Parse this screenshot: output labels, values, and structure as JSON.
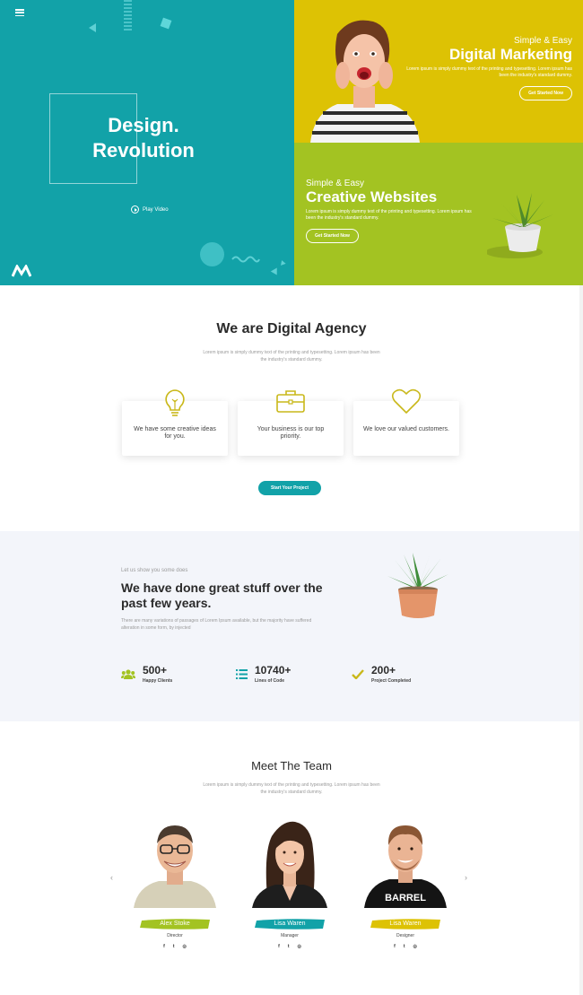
{
  "hero": {
    "left": {
      "title_line1": "Design.",
      "title_line2": "Revolution",
      "play_label": "Play Video"
    },
    "top_right": {
      "kicker": "Simple & Easy",
      "title": "Digital Marketing",
      "desc": "Lorem ipsum is simply dummy text of the printing and typesetting. Lorem ipsum has been the industry's standard dummy.",
      "button": "Get Started Now"
    },
    "bottom_right": {
      "kicker": "Simple & Easy",
      "title": "Creative Websites",
      "desc": "Lorem ipsum is simply dummy text of the printing and typesetting. Lorem ipsum has been the industry's standard dummy.",
      "button": "Get Started Now"
    }
  },
  "agency": {
    "title": "We are Digital Agency",
    "subtitle": "Lorem ipsum is simply dummy text of the printing and typesetting. Lorem ipsum has been the industry's standard dummy.",
    "cards": [
      {
        "icon": "lightbulb-icon",
        "text": "We have some creative ideas for you."
      },
      {
        "icon": "briefcase-icon",
        "text": "Your business is our top priority."
      },
      {
        "icon": "heart-icon",
        "text": "We love our valued customers."
      }
    ],
    "cta": "Start Your Project"
  },
  "stats": {
    "kicker": "Let us show you some does",
    "title": "We have done great stuff over the past few years.",
    "desc": "There are many variations of passages of Lorem Ipsum available, but the majority have suffered alteration in some form, by injected",
    "items": [
      {
        "icon": "users-icon",
        "value": "500+",
        "label": "Happy Clients"
      },
      {
        "icon": "list-icon",
        "value": "10740+",
        "label": "Lines of Code"
      },
      {
        "icon": "check-icon",
        "value": "200+",
        "label": "Project Completed"
      }
    ]
  },
  "team": {
    "title": "Meet The Team",
    "subtitle": "Lorem ipsum is simply dummy text of the printing and typesetting. Lorem ipsum has been the industry's standard dummy.",
    "members": [
      {
        "name": "Alex Stoke",
        "role": "Director",
        "color": "#a3c322"
      },
      {
        "name": "Lisa Waren",
        "role": "Manager",
        "color": "#12a2a8"
      },
      {
        "name": "Lisa Waren",
        "role": "Designer",
        "color": "#ddc204"
      }
    ],
    "social": [
      "f",
      "t",
      "◎"
    ]
  },
  "colors": {
    "teal": "#12a2a8",
    "yellow": "#ddc204",
    "green": "#a3c322"
  }
}
